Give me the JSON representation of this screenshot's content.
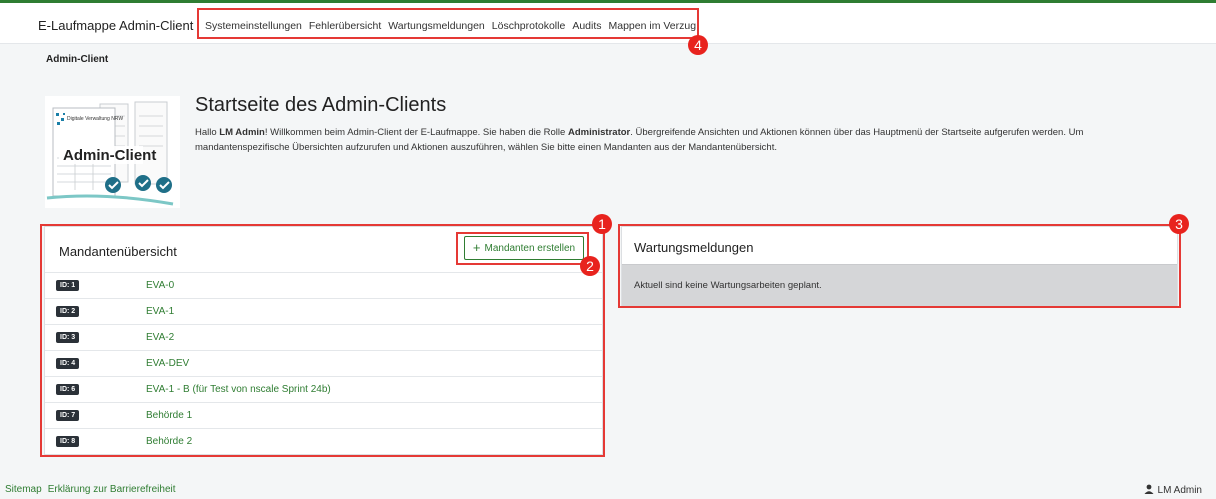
{
  "navbar": {
    "brand": "E-Laufmappe Admin-Client",
    "items": [
      {
        "label": "Systemeinstellungen"
      },
      {
        "label": "Fehlerübersicht"
      },
      {
        "label": "Wartungsmeldungen"
      },
      {
        "label": "Löschprotokolle"
      },
      {
        "label": "Audits"
      },
      {
        "label": "Mappen im Verzug"
      }
    ]
  },
  "breadcrumb": "Admin-Client",
  "hero": {
    "logo_text": "Admin-Client",
    "logo_small_text": "Digitale Verwaltung NRW"
  },
  "page": {
    "title": "Startseite des Admin-Clients",
    "intro_1": "Hallo ",
    "intro_user": "LM Admin",
    "intro_2": "! Willkommen beim Admin-Client der E-Laufmappe. Sie haben die Rolle ",
    "intro_role": "Administrator",
    "intro_3": ". Übergreifende Ansichten und Aktionen können über das Hauptmenü der Startseite aufgerufen werden. Um mandantenspezifische Übersichten aufzurufen und Aktionen auszuführen, wählen Sie bitte einen Mandanten aus der Mandantenübersicht."
  },
  "mandanten": {
    "title": "Mandantenübersicht",
    "create_label": "Mandanten erstellen",
    "rows": [
      {
        "id": "ID: 1",
        "name": "EVA-0"
      },
      {
        "id": "ID: 2",
        "name": "EVA-1"
      },
      {
        "id": "ID: 3",
        "name": "EVA-2"
      },
      {
        "id": "ID: 4",
        "name": "EVA-DEV"
      },
      {
        "id": "ID: 6",
        "name": "EVA-1 - B (für Test von nscale Sprint 24b)"
      },
      {
        "id": "ID: 7",
        "name": "Behörde 1"
      },
      {
        "id": "ID: 8",
        "name": "Behörde 2"
      }
    ]
  },
  "wartung": {
    "title": "Wartungsmeldungen",
    "message": "Aktuell sind keine Wartungsarbeiten geplant."
  },
  "annotations": [
    "1",
    "2",
    "3",
    "4"
  ],
  "footer": {
    "sitemap": "Sitemap",
    "accessibility": "Erklärung zur Barrierefreiheit",
    "user": "LM Admin"
  },
  "colors": {
    "accent": "#2f7d32",
    "annotation": "#e53935",
    "badge": "#2b3138"
  }
}
